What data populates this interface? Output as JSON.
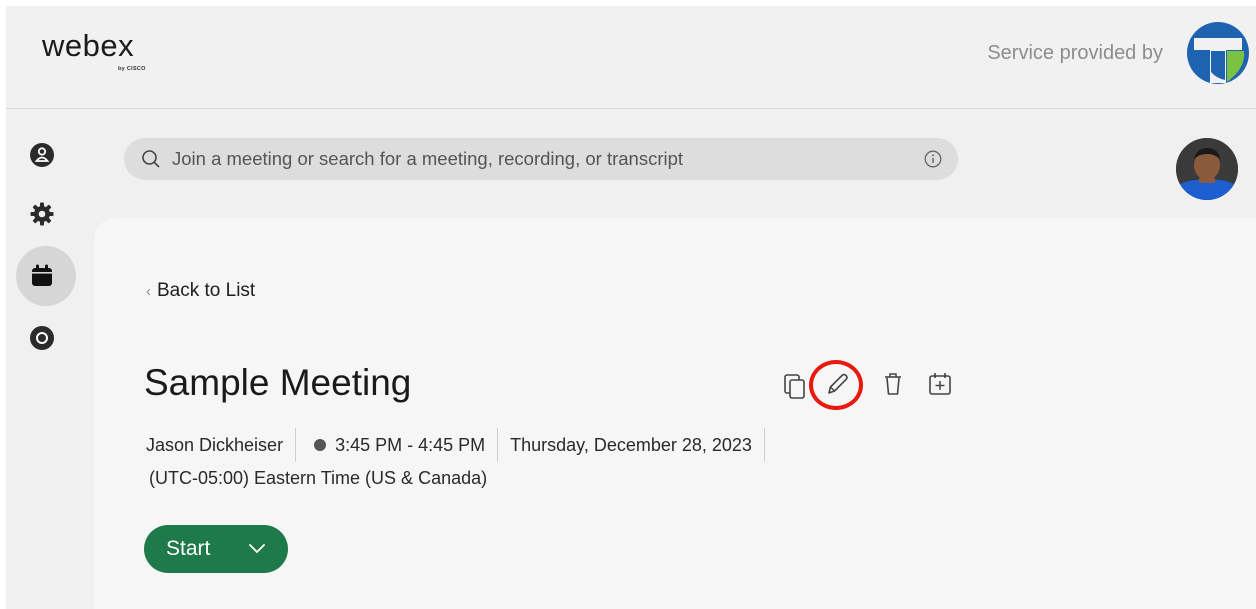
{
  "app": {
    "logo_text": "webex",
    "logo_subtext": "by CISCO",
    "service_text": "Service provided by"
  },
  "sidebar": {
    "items": [
      {
        "icon": "contacts-icon",
        "active": false
      },
      {
        "icon": "gear-icon",
        "active": false
      },
      {
        "icon": "calendar-icon",
        "active": true
      },
      {
        "icon": "recordings-icon",
        "active": false
      }
    ]
  },
  "search": {
    "placeholder": "Join a meeting or search for a meeting, recording, or transcript"
  },
  "meeting": {
    "back_label": "Back to List",
    "title": "Sample Meeting",
    "host": "Jason Dickheiser",
    "time": "3:45 PM - 4:45 PM",
    "date": "Thursday, December 28, 2023",
    "timezone": "(UTC-05:00) Eastern Time (US & Canada)",
    "actions": [
      {
        "icon": "copy-icon"
      },
      {
        "icon": "edit-pencil-icon",
        "highlighted": true
      },
      {
        "icon": "trash-icon"
      },
      {
        "icon": "add-to-calendar-icon"
      }
    ],
    "start_label": "Start"
  },
  "colors": {
    "start_button": "#1f7a4b",
    "highlight_ring": "#e8190f",
    "provider_blue": "#1e63b0",
    "provider_green": "#7cc242"
  }
}
